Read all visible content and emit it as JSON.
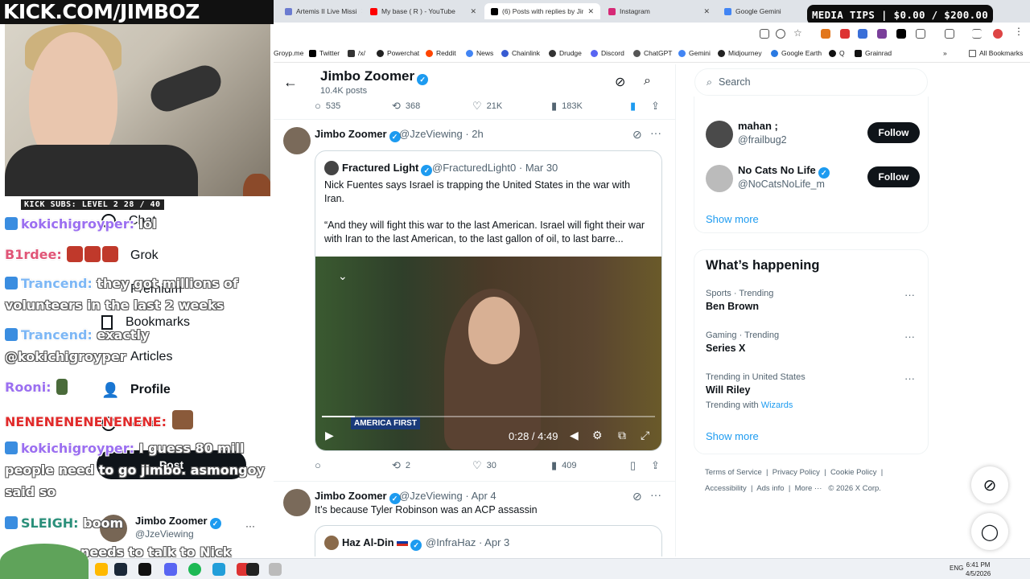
{
  "overlay": {
    "banner": "KICK.COM/JIMBOZ",
    "subs": "KICK SUBS: LEVEL 2 28 / 40",
    "nav": [
      "Chat",
      "Grok",
      "Premium",
      "Bookmarks",
      "Articles",
      "Profile",
      "More"
    ],
    "post_button": "Post",
    "account_name": "Jimbo Zoomer",
    "account_handle": "@JzeViewing",
    "chat": [
      {
        "user": "kokichigroyper:",
        "msg": "lol"
      },
      {
        "user": "B1rdee:",
        "msg": ""
      },
      {
        "user": "Trancend:",
        "msg": "they got millions of"
      },
      {
        "user": "",
        "msg": "volunteers in the last 2 weeks"
      },
      {
        "user": "Trancend:",
        "msg": "exactly"
      },
      {
        "user": "",
        "msg": "@kokichigroyper"
      },
      {
        "user": "Rooni:",
        "msg": ""
      },
      {
        "user": "NENENENENENENENE:",
        "msg": ""
      },
      {
        "user": "kokichigroyper:",
        "msg": "I guess 80 mill"
      },
      {
        "user": "",
        "msg": "people need to go jimbo. asmongoy"
      },
      {
        "user": "",
        "msg": "said so"
      },
      {
        "user": "SLEIGH:",
        "msg": "boom"
      },
      {
        "user": "",
        "msg": "needs to talk to Nick"
      }
    ]
  },
  "browser": {
    "tabs": [
      {
        "label": "Artemis II Live Missi",
        "color": "#6b7bd0"
      },
      {
        "label": "My base ( R ) - YouTube",
        "color": "#ff0000"
      },
      {
        "label": "(6) Posts with replies by Jimb",
        "color": "#000000"
      },
      {
        "label": "Instagram",
        "color": "#d62976"
      },
      {
        "label": "Google Gemini",
        "color": "#4285f4"
      }
    ],
    "bookmarks": [
      "Groyp.me",
      "Twitter",
      "/x/",
      "Powerchat",
      "Reddit",
      "News",
      "Chainlink",
      "Drudge",
      "Discord",
      "ChatGPT",
      "Gemini",
      "Midjourney",
      "Google Earth",
      "Q",
      "Grainrad",
      "All Bookmarks"
    ]
  },
  "media_tips": "MEDIA TIPS | $0.00 / $200.00",
  "header": {
    "name": "Jimbo Zoomer",
    "posts": "10.4K posts"
  },
  "top_actions": {
    "replies": "535",
    "reposts": "368",
    "likes": "21K",
    "views": "183K"
  },
  "tweet1": {
    "name": "Jimbo Zoomer",
    "handle": "@JzeViewing",
    "time": "2h",
    "quote": {
      "name": "Fractured Light",
      "handle": "@FracturedLight0",
      "date": "Mar 30",
      "text1": "Nick Fuentes says Israel is trapping the United States in the war with Iran.",
      "text2": "“And they will fight this war to the last American. Israel will fight their war with Iran to the last American, to the last gallon of oil, to last barre...",
      "video_time": "0:28 / 4:49",
      "video_caption": "AMERICA FIRST",
      "progress": 0.1
    },
    "actions": {
      "replies": "",
      "reposts": "2",
      "likes": "30",
      "views": "409"
    }
  },
  "tweet2": {
    "name": "Jimbo Zoomer",
    "handle": "@JzeViewing",
    "date": "Apr 4",
    "text": "It’s because Tyler Robinson was an ACP assassin",
    "quote": {
      "name": "Haz Al-Din",
      "handle": "@InfraHaz",
      "date": "Apr 3"
    }
  },
  "sidebar": {
    "search_placeholder": "Search",
    "who_to_follow": [
      {
        "name": "mahan ;",
        "handle": "@frailbug2",
        "button": "Follow"
      },
      {
        "name": "No Cats No Life",
        "handle": "@NoCatsNoLife_m",
        "button": "Follow"
      }
    ],
    "show_more": "Show more",
    "happening_title": "What’s happening",
    "trends": [
      {
        "category": "Sports · Trending",
        "topic": "Ben Brown"
      },
      {
        "category": "Gaming · Trending",
        "topic": "Series X"
      },
      {
        "category": "Trending in United States",
        "topic": "Will Riley",
        "extra": "Trending with",
        "extra_link": "Wizards"
      }
    ],
    "footer1": [
      "Terms of Service",
      "Privacy Policy",
      "Cookie Policy"
    ],
    "footer2": [
      "Accessibility",
      "Ads info",
      "More ···",
      "© 2026 X Corp."
    ]
  },
  "taskbar": {
    "lang": "ENG",
    "time": "6:41 PM",
    "date": "4/5/2026"
  }
}
